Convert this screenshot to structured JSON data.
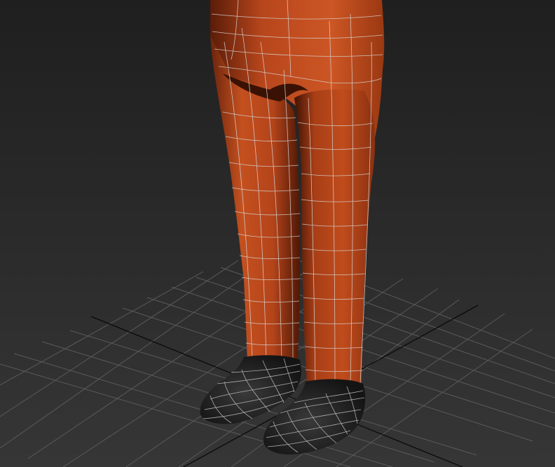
{
  "viewport": {
    "background_top": "#1f1f1f",
    "background_bottom": "#363636",
    "grid_color": "#5a5a5a",
    "axis_color": "#0a0a0a"
  },
  "model": {
    "body_color": "#b8461c",
    "body_highlight": "#d25a2a",
    "body_shadow": "#5c1c08",
    "shoe_color": "#2e2e2e",
    "shoe_shadow": "#151515",
    "wire_color": "#d8d8d8"
  }
}
